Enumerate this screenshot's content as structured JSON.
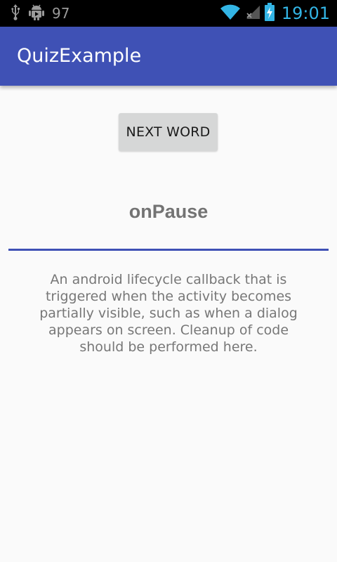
{
  "status_bar": {
    "battery_level": "97",
    "time": "19:01",
    "icons": [
      "usb-icon",
      "android-debug-icon",
      "wifi-icon",
      "signal-icon",
      "battery-charging-icon"
    ],
    "clock_color": "#33b5e5"
  },
  "app_bar": {
    "title": "QuizExample",
    "color": "#3f51b5"
  },
  "main": {
    "next_button_label": "NEXT WORD",
    "word": "onPause",
    "definition": "An android lifecycle callback that is triggered when the activity becomes partially visible, such as when a dialog appears on screen. Cleanup of code should be performed here."
  }
}
